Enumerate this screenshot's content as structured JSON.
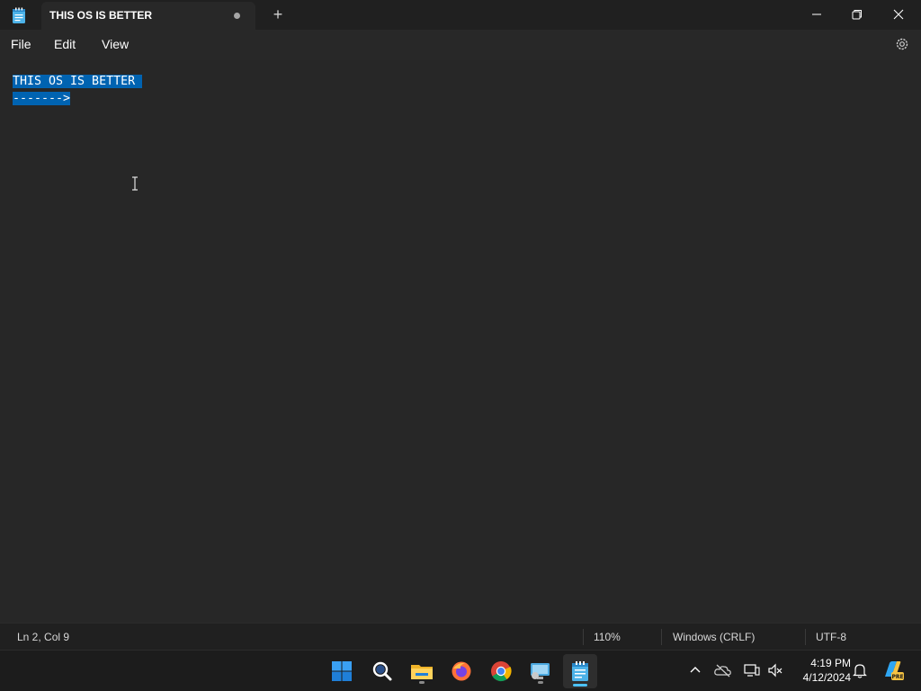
{
  "window": {
    "tab_title": "THIS OS IS BETTER",
    "new_tab_label": "+"
  },
  "menu": {
    "file": "File",
    "edit": "Edit",
    "view": "View"
  },
  "editor": {
    "lines": [
      "THIS OS IS BETTER ",
      "------->"
    ]
  },
  "status": {
    "position": "Ln 2, Col 9",
    "zoom": "110%",
    "line_ending": "Windows (CRLF)",
    "encoding": "UTF-8"
  },
  "taskbar": {
    "icons": [
      "windows-start-icon",
      "search-icon",
      "file-explorer-icon",
      "firefox-icon",
      "chrome-icon",
      "remote-desktop-icon",
      "notepad-icon"
    ],
    "clock_time": "4:19 PM",
    "clock_date": "4/12/2024"
  },
  "colors": {
    "selection": "#0063b1",
    "accent": "#4cc2ff",
    "background": "#202020"
  }
}
